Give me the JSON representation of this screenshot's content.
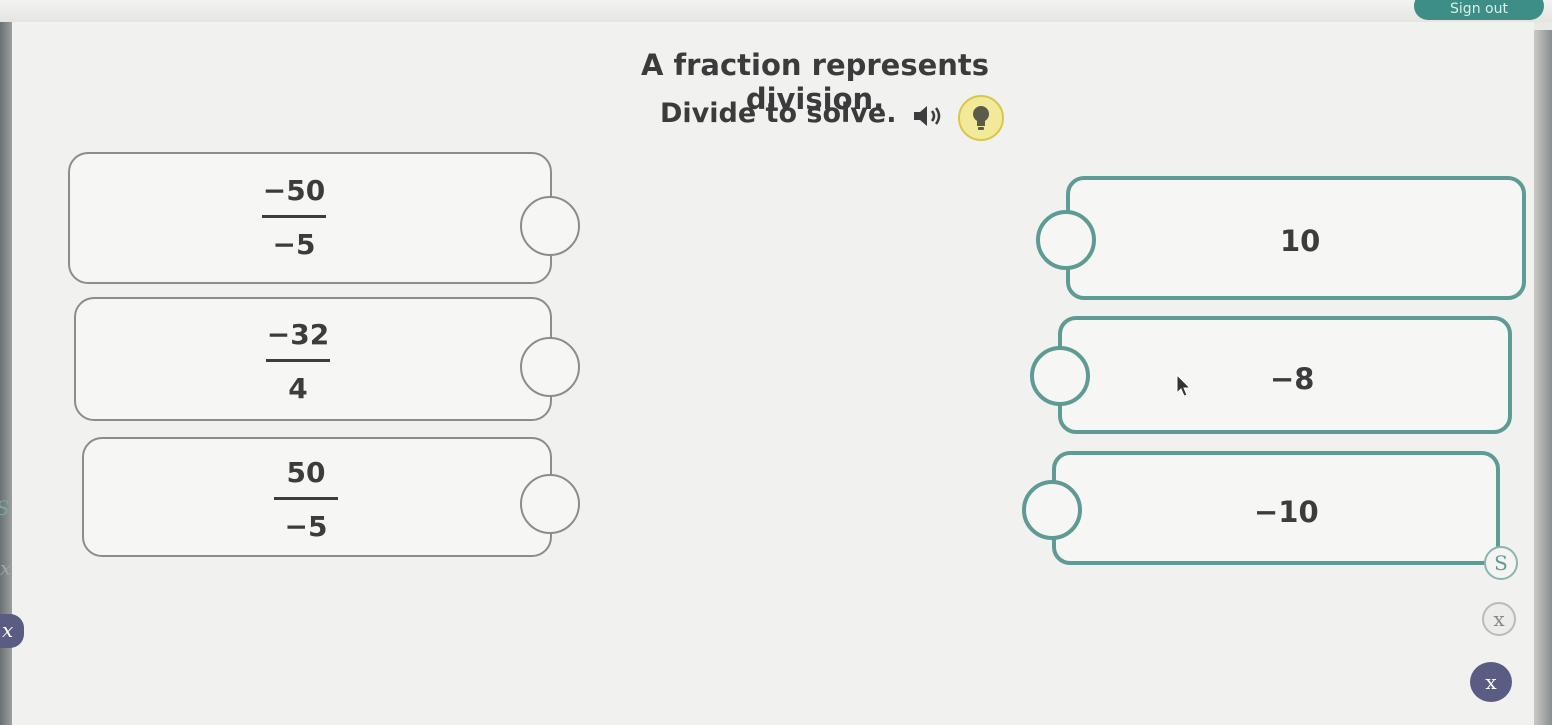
{
  "header": {
    "signout_label": "Sign out"
  },
  "question": {
    "title": "A fraction represents division.",
    "instruction": "Divide to solve.",
    "speaker_icon": "speaker-icon",
    "hint_icon": "lightbulb-icon"
  },
  "left_cards": [
    {
      "numerator": "−50",
      "denominator": "−5"
    },
    {
      "numerator": "−32",
      "denominator": "4"
    },
    {
      "numerator": "50",
      "denominator": "−5"
    }
  ],
  "right_cards": [
    {
      "value": "10"
    },
    {
      "value": "−8"
    },
    {
      "value": "−10"
    }
  ],
  "tools": {
    "s_label": "S",
    "x_label": "x"
  },
  "left_edge": {
    "s_label": "S",
    "x_label": "x"
  },
  "colors": {
    "accent_teal": "#5e9b95",
    "hint_yellow": "#f2ea9a",
    "text": "#3c3c3c"
  }
}
